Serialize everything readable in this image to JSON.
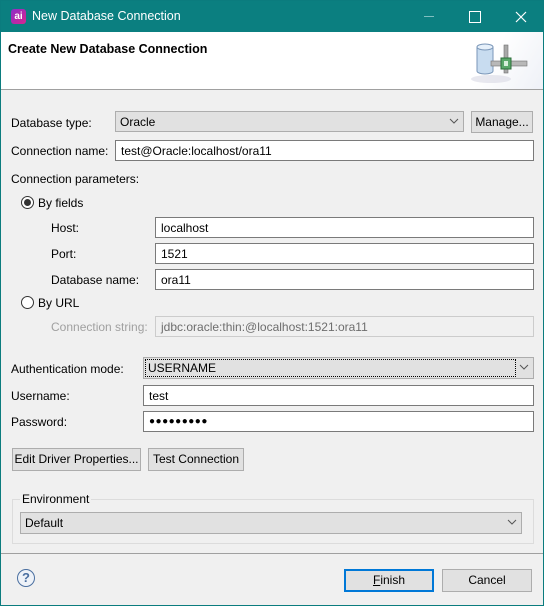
{
  "window": {
    "title": "New Database Connection",
    "app_icon_glyph": "ai",
    "controls": {
      "minimize": "minimize-icon",
      "maximize": "maximize-icon",
      "close": "close-icon",
      "close_glyph": "✕"
    }
  },
  "header": {
    "title": "Create New Database Connection",
    "icon": "database-connection-icon"
  },
  "form": {
    "database_type": {
      "label": "Database type:",
      "value": "Oracle",
      "manage_label": "Manage..."
    },
    "connection_name": {
      "label": "Connection name:",
      "value": "test@Oracle:localhost/ora11"
    },
    "connection_parameters": {
      "label": "Connection parameters:",
      "by_fields": {
        "label": "By fields",
        "selected": true,
        "host": {
          "label": "Host:",
          "value": "localhost"
        },
        "port": {
          "label": "Port:",
          "value": "1521"
        },
        "database_name": {
          "label": "Database name:",
          "value": "ora11"
        }
      },
      "by_url": {
        "label": "By URL",
        "selected": false,
        "connection_string": {
          "label": "Connection string:",
          "value": "jdbc:oracle:thin:@localhost:1521:ora11",
          "disabled": true
        }
      }
    },
    "authentication_mode": {
      "label": "Authentication mode:",
      "value": "USERNAME"
    },
    "username": {
      "label": "Username:",
      "value": "test"
    },
    "password": {
      "label": "Password:",
      "value": "●●●●●●●●●"
    },
    "buttons": {
      "edit_driver_properties": "Edit Driver Properties...",
      "test_connection": "Test Connection"
    },
    "environment": {
      "label": "Environment",
      "value": "Default"
    }
  },
  "footer": {
    "help_glyph": "?",
    "finish_label": "Finish",
    "finish_mnemonic": "F",
    "finish_rest": "inish",
    "cancel_label": "Cancel"
  },
  "colors": {
    "titlebar": "#0b7f80",
    "default_button_border": "#0078d7",
    "dialog_background": "#f0f0f0"
  }
}
